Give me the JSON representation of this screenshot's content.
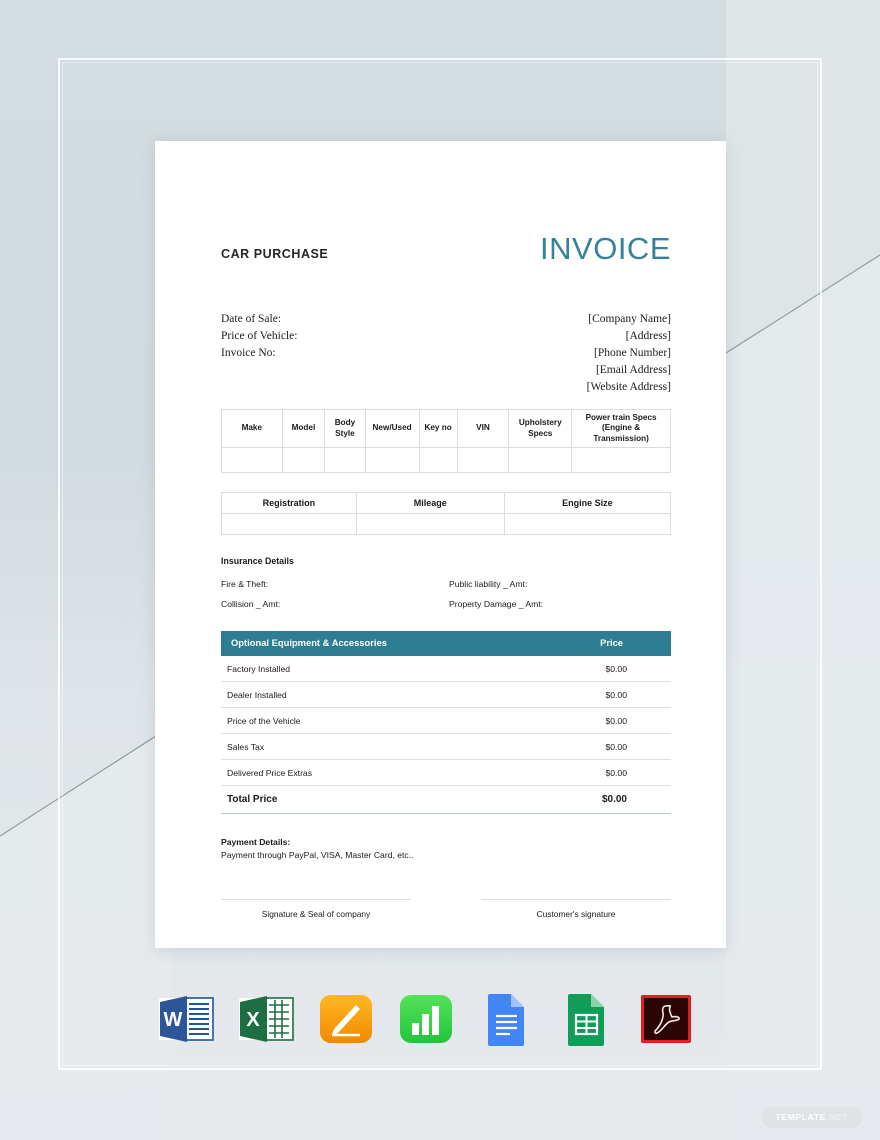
{
  "document": {
    "kicker": "CAR PURCHASE",
    "title": "INVOICE"
  },
  "meta": {
    "left": [
      "Date of Sale:",
      "Price of Vehicle:",
      "Invoice No:"
    ],
    "right": [
      "[Company Name]",
      "[Address]",
      "[Phone Number]",
      "[Email Address]",
      "[Website Address]"
    ]
  },
  "vehicle_table": {
    "headers": [
      "Make",
      "Model",
      "Body Style",
      "New/Used",
      "Key no",
      "VIN",
      "Upholstery Specs",
      "Power train Specs (Engine & Transmission)"
    ],
    "row": [
      "",
      "",
      "",
      "",
      "",
      "",
      "",
      ""
    ]
  },
  "registration_table": {
    "headers": [
      "Registration",
      "Mileage",
      "Engine Size"
    ],
    "row": [
      "",
      "",
      ""
    ]
  },
  "insurance": {
    "title": "Insurance Details",
    "rows": [
      {
        "left": "Fire & Theft:",
        "right": "Public liability _ Amt:"
      },
      {
        "left": "Collision _ Amt:",
        "right": "Property Damage _ Amt:"
      }
    ]
  },
  "items": {
    "header": {
      "label": "Optional Equipment & Accessories",
      "price": "Price"
    },
    "rows": [
      {
        "label": "Factory Installed",
        "amount": "$0.00"
      },
      {
        "label": "Dealer Installed",
        "amount": "$0.00"
      },
      {
        "label": "Price of the Vehicle",
        "amount": "$0.00"
      },
      {
        "label": "Sales Tax",
        "amount": "$0.00"
      },
      {
        "label": "Delivered Price Extras",
        "amount": "$0.00"
      }
    ],
    "total": {
      "label": "Total Price",
      "amount": "$0.00"
    }
  },
  "payment": {
    "title": "Payment Details:",
    "detail": "Payment through PayPal, VISA, Master Card, etc.."
  },
  "signatures": {
    "company": "Signature & Seal of company",
    "customer": "Customer's signature"
  },
  "formats": [
    {
      "name": "ms-word-icon",
      "label": "W"
    },
    {
      "name": "ms-excel-icon",
      "label": "X"
    },
    {
      "name": "apple-pages-icon",
      "label": ""
    },
    {
      "name": "apple-numbers-icon",
      "label": ""
    },
    {
      "name": "google-docs-icon",
      "label": ""
    },
    {
      "name": "google-sheets-icon",
      "label": ""
    },
    {
      "name": "pdf-icon",
      "label": ""
    }
  ],
  "watermark": {
    "name": "TEMPLATE",
    "suffix": ".NET"
  },
  "colors": {
    "accent_teal": "#2e7e93",
    "title_teal": "#37829a",
    "backdrop": "#d3dce0",
    "page": "#ffffff"
  }
}
